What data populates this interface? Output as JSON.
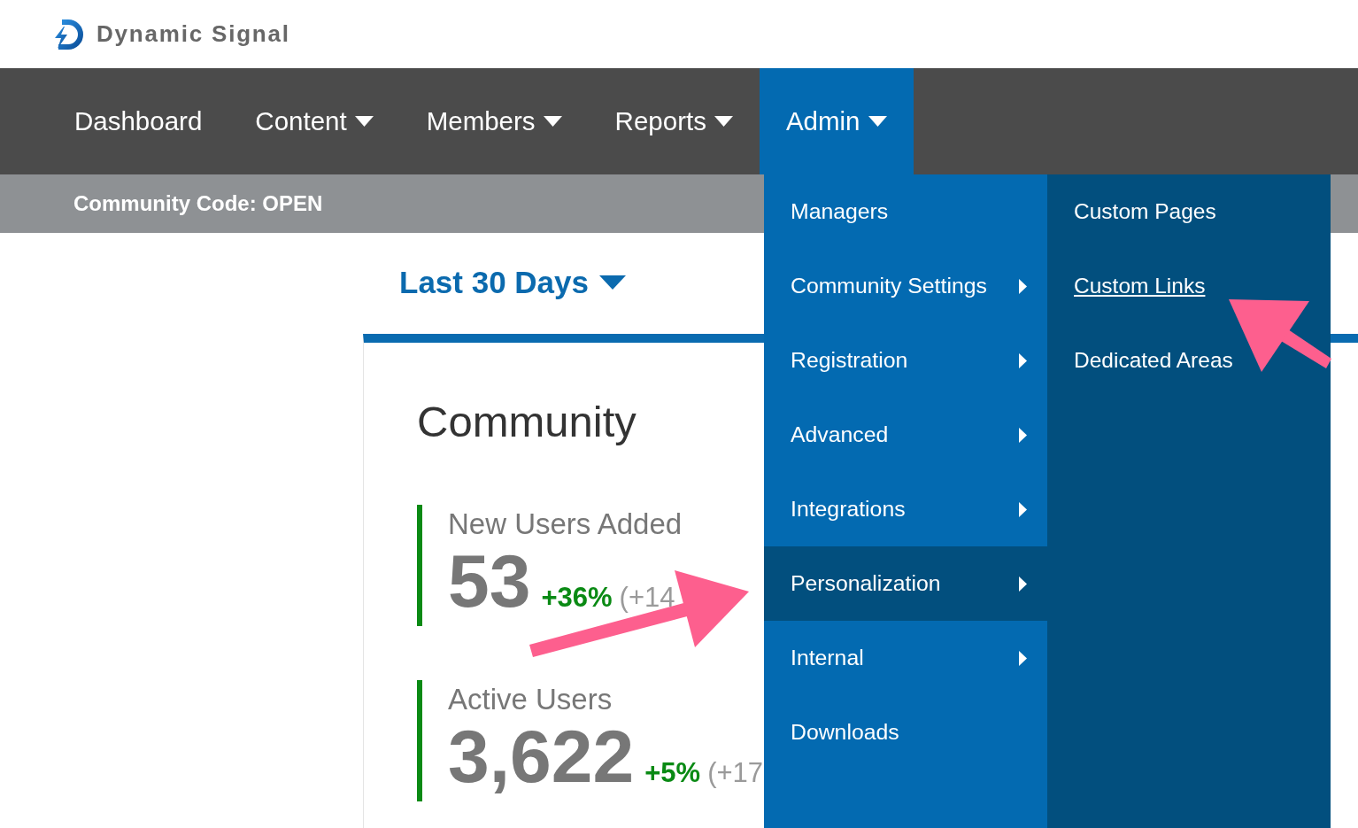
{
  "header": {
    "logo_text": "Dynamic Signal"
  },
  "nav": {
    "items": [
      {
        "label": "Dashboard",
        "has_dropdown": false,
        "selected": false
      },
      {
        "label": "Content",
        "has_dropdown": true,
        "selected": false
      },
      {
        "label": "Members",
        "has_dropdown": true,
        "selected": false
      },
      {
        "label": "Reports",
        "has_dropdown": true,
        "selected": false
      },
      {
        "label": "Admin",
        "has_dropdown": true,
        "selected": true
      }
    ]
  },
  "community_code": "Community Code: OPEN",
  "date_range": {
    "label": "Last 30 Days"
  },
  "card": {
    "title": "Community",
    "metrics": [
      {
        "label": "New Users Added",
        "value": "53",
        "change": "+36%",
        "delta": "(+14"
      },
      {
        "label": "Active Users",
        "value": "3,622",
        "change": "+5%",
        "delta": "(+17"
      }
    ]
  },
  "admin_menu": {
    "items": [
      {
        "label": "Managers",
        "has_submenu": false,
        "selected": false
      },
      {
        "label": "Community Settings",
        "has_submenu": true,
        "selected": false
      },
      {
        "label": "Registration",
        "has_submenu": true,
        "selected": false
      },
      {
        "label": "Advanced",
        "has_submenu": true,
        "selected": false
      },
      {
        "label": "Integrations",
        "has_submenu": true,
        "selected": false
      },
      {
        "label": "Personalization",
        "has_submenu": true,
        "selected": true
      },
      {
        "label": "Internal",
        "has_submenu": true,
        "selected": false
      },
      {
        "label": "Downloads",
        "has_submenu": false,
        "selected": false
      }
    ]
  },
  "submenu": {
    "items": [
      {
        "label": "Custom Pages",
        "hovered": false
      },
      {
        "label": "Custom Links",
        "hovered": true
      },
      {
        "label": "Dedicated Areas",
        "hovered": false
      }
    ]
  }
}
